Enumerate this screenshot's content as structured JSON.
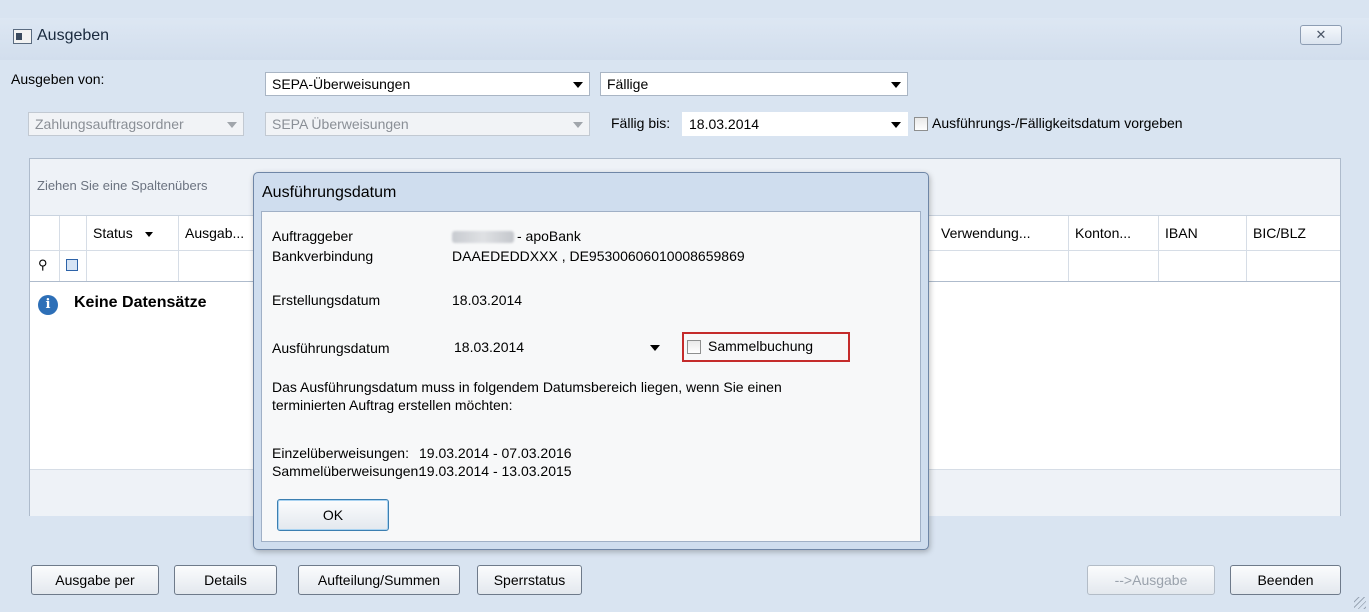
{
  "window": {
    "title": "Ausgeben",
    "close_label": "✕"
  },
  "toolbar": {
    "ausgeben_von_label": "Ausgeben von:",
    "type_combo": "SEPA-Überweisungen",
    "status_combo": "Fällige",
    "auftragsordner_combo": "Zahlungsauftragsordner",
    "sepa_combo_disabled": "SEPA Überweisungen",
    "faellig_bis_label": "Fällig bis:",
    "faellig_bis_value": "18.03.2014",
    "vorgeben_label": "Ausführungs-/Fälligkeitsdatum vorgeben"
  },
  "grid": {
    "group_hint": "Ziehen Sie eine Spaltenübers",
    "columns": [
      "Status",
      "Ausgab...",
      "Verwendung...",
      "Konton...",
      "IBAN",
      "BIC/BLZ"
    ],
    "empty_text": "Keine Datensätze"
  },
  "buttons": {
    "ausgabe_per": "Ausgabe per",
    "details": "Details",
    "aufteilung": "Aufteilung/Summen",
    "sperrstatus": "Sperrstatus",
    "ausgabe": "-->Ausgabe",
    "beenden": "Beenden"
  },
  "dialog": {
    "title": "Ausführungsdatum",
    "auftraggeber_label": "Auftraggeber",
    "auftraggeber_value": "- apoBank",
    "bankverbindung_label": "Bankverbindung",
    "bankverbindung_value": "DAAEDEDDXXX , DE95300606010008659869",
    "erstellungsdatum_label": "Erstellungsdatum",
    "erstellungsdatum_value": "18.03.2014",
    "ausfuehrungsdatum_label": "Ausführungsdatum",
    "ausfuehrungsdatum_value": "18.03.2014",
    "sammelbuchung_label": "Sammelbuchung",
    "info_line1": "Das Ausführungsdatum muss in folgendem Datumsbereich liegen, wenn Sie einen",
    "info_line2": "terminierten Auftrag erstellen möchten:",
    "einzel_label": "Einzelüberweisungen:",
    "einzel_value": "19.03.2014 - 07.03.2016",
    "sammel_label": "Sammelüberweisungen:",
    "sammel_value": "19.03.2014 - 13.03.2015",
    "ok_label": "OK"
  }
}
